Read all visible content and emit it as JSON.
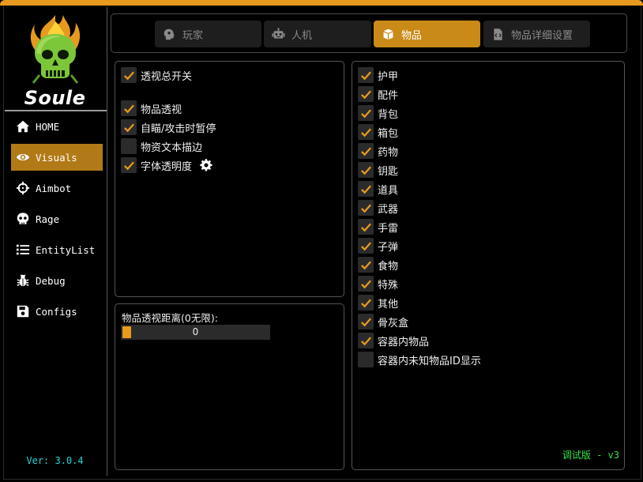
{
  "app": {
    "logo_text": "Soule",
    "version": "Ver: 3.0.4",
    "debug_label": "调试版 - v3"
  },
  "sidebar": {
    "items": [
      {
        "label": "HOME",
        "icon": "home-icon"
      },
      {
        "label": "Visuals",
        "icon": "eye-icon",
        "active": true
      },
      {
        "label": "Aimbot",
        "icon": "crosshair-icon"
      },
      {
        "label": "Rage",
        "icon": "skull-icon"
      },
      {
        "label": "EntityList",
        "icon": "list-icon"
      },
      {
        "label": "Debug",
        "icon": "bug-icon"
      },
      {
        "label": "Configs",
        "icon": "floppy-icon"
      }
    ]
  },
  "tabs": [
    {
      "label": "玩家",
      "icon": "head-icon"
    },
    {
      "label": "人机",
      "icon": "robot-icon"
    },
    {
      "label": "物品",
      "icon": "boxes-icon",
      "active": true
    },
    {
      "label": "物品详细设置",
      "icon": "code-file-icon"
    }
  ],
  "left_panel": {
    "options": [
      {
        "label": "透视总开关",
        "checked": true
      },
      {
        "label": "物品透视",
        "checked": true
      },
      {
        "label": "自瞄/攻击时暂停",
        "checked": true
      },
      {
        "label": "物资文本描边",
        "checked": false
      },
      {
        "label": "字体透明度",
        "checked": true,
        "has_settings": true
      }
    ]
  },
  "distance": {
    "label": "物品透视距离(0无限):",
    "value": "0",
    "fraction": 0.0
  },
  "right_panel": {
    "items": [
      {
        "label": "护甲",
        "checked": true
      },
      {
        "label": "配件",
        "checked": true
      },
      {
        "label": "背包",
        "checked": true
      },
      {
        "label": "箱包",
        "checked": true
      },
      {
        "label": "药物",
        "checked": true
      },
      {
        "label": "钥匙",
        "checked": true
      },
      {
        "label": "道具",
        "checked": true
      },
      {
        "label": "武器",
        "checked": true
      },
      {
        "label": "手雷",
        "checked": true
      },
      {
        "label": "子弹",
        "checked": true
      },
      {
        "label": "食物",
        "checked": true
      },
      {
        "label": "特殊",
        "checked": true
      },
      {
        "label": "其他",
        "checked": true
      },
      {
        "label": "骨灰盒",
        "checked": true
      },
      {
        "label": "容器内物品",
        "checked": true
      },
      {
        "label": "容器内未知物品ID显示",
        "checked": false
      }
    ]
  },
  "colors": {
    "accent": "#e79a1e",
    "active_nav": "#b17a17",
    "active_tab": "#c98a18",
    "version": "#2bd3d6",
    "debug": "#33e04a"
  }
}
